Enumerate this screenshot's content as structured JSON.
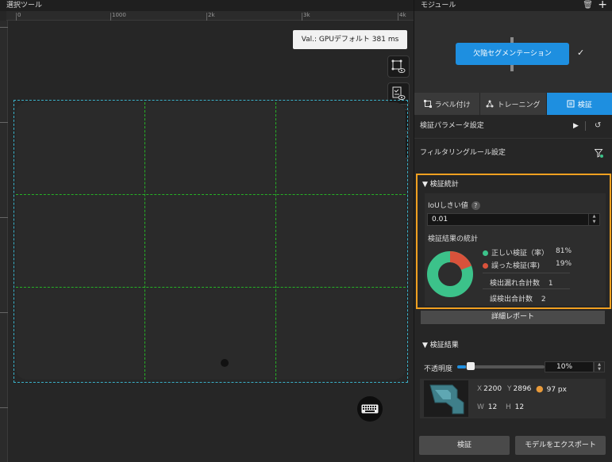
{
  "left_panel": {
    "title": "選択ツール",
    "ruler_labels": [
      "0",
      "1000",
      "2k",
      "3k",
      "4k"
    ],
    "val_badge": "Val.: GPUデフォルト 381 ms",
    "tools": [
      "bbox-eye-icon",
      "checklist-eye-icon",
      "grid-eye-icon",
      "file-eye-icon"
    ]
  },
  "right_panel": {
    "module_header": "モジュール",
    "module_name": "欠陥セグメンテーション",
    "tabs": [
      {
        "label": "ラベル付け",
        "icon": "bbox-icon",
        "active": false
      },
      {
        "label": "トレーニング",
        "icon": "network-icon",
        "active": false
      },
      {
        "label": "検証",
        "icon": "validate-icon",
        "active": true
      }
    ],
    "param_settings": "検証パラメータ設定",
    "filter_settings": "フィルタリングルール設定",
    "stats": {
      "header": "検証統計",
      "iou_label": "IoUしきい値",
      "iou_help": "?",
      "iou_value": "0.01",
      "stat_title": "検証結果の統計",
      "correct_label": "正しい検証（率）",
      "correct_value": "81%",
      "wrong_label": "誤った検証(率)",
      "wrong_value": "19%",
      "missed_label": "検出漏れ合計数",
      "missed_value": "1",
      "false_label": "誤検出合計数",
      "false_value": "2",
      "colors": {
        "correct": "#3cc28a",
        "wrong": "#d9523b"
      },
      "correct_fraction": 0.81
    },
    "detail_report": "詳細レポート",
    "results": {
      "header": "検証結果",
      "opacity_label": "不透明度",
      "opacity_value": "10%",
      "x_label": "X",
      "x_value": "2200",
      "y_label": "Y",
      "y_value": "2896",
      "area_value": "97 px",
      "w_label": "W",
      "w_value": "12",
      "h_label": "H",
      "h_value": "12"
    },
    "validate_button": "検証",
    "export_button": "モデルをエクスポート"
  }
}
